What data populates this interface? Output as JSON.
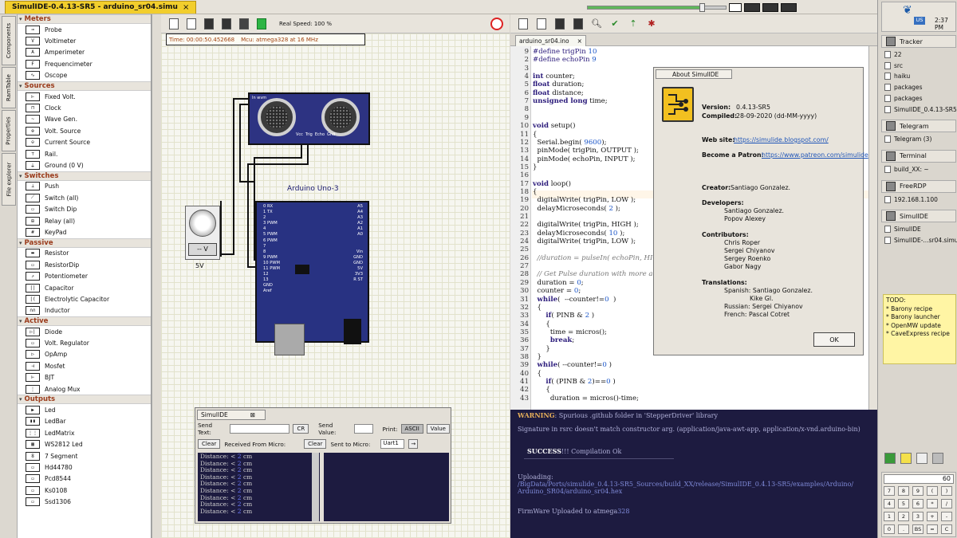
{
  "window": {
    "title": "SimulIDE-0.4.13-SR5  -  arduino_sr04.simu",
    "close": "×"
  },
  "vtabs": [
    "Components",
    "RamTable",
    "Properties",
    "File explorer"
  ],
  "components": [
    {
      "category": "Meters",
      "items": [
        {
          "icon": "probe-icon",
          "glyph": "⊸",
          "label": "Probe"
        },
        {
          "icon": "voltimeter-icon",
          "glyph": "V",
          "label": "Voltimeter"
        },
        {
          "icon": "amperimeter-icon",
          "glyph": "A",
          "label": "Amperimeter"
        },
        {
          "icon": "frequencimeter-icon",
          "glyph": "F",
          "label": "Frequencimeter"
        },
        {
          "icon": "oscope-icon",
          "glyph": "∿",
          "label": "Oscope"
        }
      ]
    },
    {
      "category": "Sources",
      "items": [
        {
          "icon": "fixed-volt-icon",
          "glyph": "⊢",
          "label": "Fixed Volt."
        },
        {
          "icon": "clock-icon",
          "glyph": "⊓",
          "label": "Clock"
        },
        {
          "icon": "wave-gen-icon",
          "glyph": "~",
          "label": "Wave Gen."
        },
        {
          "icon": "volt-source-icon",
          "glyph": "⊕",
          "label": "Volt. Source"
        },
        {
          "icon": "current-source-icon",
          "glyph": "⊖",
          "label": "Current Source"
        },
        {
          "icon": "rail-icon",
          "glyph": "⊤",
          "label": "Rail."
        },
        {
          "icon": "ground-icon",
          "glyph": "⏚",
          "label": "Ground (0 V)"
        }
      ]
    },
    {
      "category": "Switches",
      "items": [
        {
          "icon": "push-icon",
          "glyph": "⊥",
          "label": "Push"
        },
        {
          "icon": "switch-all-icon",
          "glyph": "⟋",
          "label": "Switch (all)"
        },
        {
          "icon": "switch-dip-icon",
          "glyph": "▭",
          "label": "Switch Dip"
        },
        {
          "icon": "relay-icon",
          "glyph": "⊞",
          "label": "Relay (all)"
        },
        {
          "icon": "keypad-icon",
          "glyph": "#",
          "label": "KeyPad"
        }
      ]
    },
    {
      "category": "Passive",
      "items": [
        {
          "icon": "resistor-icon",
          "glyph": "▬",
          "label": "Resistor"
        },
        {
          "icon": "resistor-dip-icon",
          "glyph": "▭",
          "label": "ResistorDip"
        },
        {
          "icon": "potentiometer-icon",
          "glyph": "↗",
          "label": "Potentiometer"
        },
        {
          "icon": "capacitor-icon",
          "glyph": "||",
          "label": "Capacitor"
        },
        {
          "icon": "electrolytic-capacitor-icon",
          "glyph": "|(",
          "label": "Electrolytic Capacitor"
        },
        {
          "icon": "inductor-icon",
          "glyph": "∩∩",
          "label": "Inductor"
        }
      ]
    },
    {
      "category": "Active",
      "items": [
        {
          "icon": "diode-icon",
          "glyph": "▷|",
          "label": "Diode"
        },
        {
          "icon": "volt-regulator-icon",
          "glyph": "▭",
          "label": "Volt. Regulator"
        },
        {
          "icon": "opamp-icon",
          "glyph": "▷",
          "label": "OpAmp"
        },
        {
          "icon": "mosfet-icon",
          "glyph": "⊣",
          "label": "Mosfet"
        },
        {
          "icon": "bjt-icon",
          "glyph": "⊢",
          "label": "BJT"
        },
        {
          "icon": "analog-mux-icon",
          "glyph": "⋮",
          "label": "Analog Mux"
        }
      ]
    },
    {
      "category": "Outputs",
      "items": [
        {
          "icon": "led-icon",
          "glyph": "▶",
          "label": "Led"
        },
        {
          "icon": "ledbar-icon",
          "glyph": "▮▮",
          "label": "LedBar"
        },
        {
          "icon": "ledmatrix-icon",
          "glyph": "⋮⋮",
          "label": "LedMatrix"
        },
        {
          "icon": "ws2812-icon",
          "glyph": "▦",
          "label": "WS2812 Led"
        },
        {
          "icon": "seven-segment-icon",
          "glyph": "8",
          "label": "7 Segment"
        },
        {
          "icon": "hd44780-icon",
          "glyph": "▭",
          "label": "Hd44780"
        },
        {
          "icon": "pcd8544-icon",
          "glyph": "▭",
          "label": "Pcd8544"
        },
        {
          "icon": "ks0108-icon",
          "glyph": "▭",
          "label": "Ks0108"
        },
        {
          "icon": "ssd1306-icon",
          "glyph": "▭",
          "label": "Ssd1306"
        }
      ]
    }
  ],
  "circuit": {
    "real_speed": "Real Speed: 100 %",
    "time": "Time: 00:00:50.452668",
    "mcu": "Mcu: atmega328 at 16 MHz",
    "sonar_label": "In  wvm",
    "sonar_pins": [
      "Vcc",
      "Trig",
      "Echo",
      "Gnd"
    ],
    "arduino_title": "Arduino Uno-3",
    "arduino_left_pins": [
      "0  RX",
      "1  TX",
      "2",
      "3  PWM",
      "4",
      "5  PWM",
      "6  PWM",
      "7",
      "8",
      "9   PWM",
      "10 PWM",
      "11 PWM",
      "12",
      "13",
      "GND",
      "Aref"
    ],
    "arduino_right_pins": [
      "A5",
      "A4",
      "A3",
      "A2",
      "A1",
      "A0",
      "",
      "",
      "Vin",
      "GND",
      "GND",
      "5V",
      "3V3",
      "R ST"
    ],
    "volt_button": "-- V",
    "volt_value": "5V"
  },
  "serial": {
    "tab": "SimulIDE",
    "close": "⊠",
    "send_text_label": "Send Text:",
    "cr": "CR",
    "send_value_label": "Send Value:",
    "print_label": "Print:",
    "ascii": "ASCII",
    "value": "Value",
    "clear1": "Clear",
    "received_label": "Received From Micro:",
    "clear2": "Clear",
    "sent_label": "Sent to Micro:",
    "port": "Uart1",
    "port_arrow": "→",
    "rx_lines": [
      {
        "t": "Distance: < ",
        "n": "2",
        "u": " cm"
      },
      {
        "t": "Distance: < ",
        "n": "2",
        "u": " cm"
      },
      {
        "t": "Distance: < ",
        "n": "2",
        "u": " cm"
      },
      {
        "t": "Distance: < ",
        "n": "2",
        "u": " cm"
      },
      {
        "t": "Distance: < ",
        "n": "2",
        "u": " cm"
      },
      {
        "t": "Distance: < ",
        "n": "2",
        "u": " cm"
      },
      {
        "t": "Distance: < ",
        "n": "2",
        "u": " cm"
      },
      {
        "t": "Distance: < ",
        "n": "2",
        "u": " cm"
      },
      {
        "t": "Distance: < ",
        "n": "2",
        "u": " cm"
      }
    ]
  },
  "editor": {
    "tab": "arduino_sr04.ino",
    "tab_close": "×",
    "lines": [
      {
        "n": "9",
        "html": "<span class='pp'>#define trigPin</span> <span class='num'>10</span>"
      },
      {
        "n": "2",
        "html": "<span class='pp'>#define echoPin</span> <span class='num'>9</span>"
      },
      {
        "n": "3",
        "html": ""
      },
      {
        "n": "4",
        "html": "<span class='kw'>int</span> counter;"
      },
      {
        "n": "5",
        "html": "<span class='kw'>float</span> duration;"
      },
      {
        "n": "6",
        "html": "<span class='kw'>float</span> distance;"
      },
      {
        "n": "7",
        "html": "<span class='kw'>unsigned long</span> time;"
      },
      {
        "n": "8",
        "html": ""
      },
      {
        "n": "9",
        "html": ""
      },
      {
        "n": "10",
        "html": "<span class='kw'>void</span> setup()"
      },
      {
        "n": "11",
        "html": "{"
      },
      {
        "n": "12",
        "html": "  Serial.begin( <span class='num'>9600</span>);"
      },
      {
        "n": "13",
        "html": "  pinMode( trigPin, OUTPUT );"
      },
      {
        "n": "14",
        "html": "  pinMode( echoPin, INPUT );"
      },
      {
        "n": "15",
        "html": "}"
      },
      {
        "n": "16",
        "html": ""
      },
      {
        "n": "17",
        "html": "<span class='kw'>void</span> loop()"
      },
      {
        "n": "18",
        "html": "{"
      },
      {
        "n": "19",
        "html": "  digitalWrite( trigPin, LOW );"
      },
      {
        "n": "20",
        "html": "  delayMicroseconds( <span class='num'>2</span> );"
      },
      {
        "n": "21",
        "html": ""
      },
      {
        "n": "22",
        "html": "  digitalWrite( trigPin, HIGH );"
      },
      {
        "n": "23",
        "html": "  delayMicroseconds( <span class='num'>10</span> );"
      },
      {
        "n": "24",
        "html": "  digitalWrite( trigPin, LOW );"
      },
      {
        "n": "25",
        "html": ""
      },
      {
        "n": "26",
        "html": "  <span class='cm'>//duration = pulseIn( echoPin, HIGH );</span>"
      },
      {
        "n": "27",
        "html": ""
      },
      {
        "n": "28",
        "html": "  <span class='cm'>// Get Pulse duration with more accuracy</span>"
      },
      {
        "n": "29",
        "html": "  duration = <span class='num'>0</span>;"
      },
      {
        "n": "30",
        "html": "  counter = <span class='num'>0</span>;"
      },
      {
        "n": "31",
        "html": "  <span class='kw'>while</span>(  --counter!=<span class='num'>0</span>  )"
      },
      {
        "n": "32",
        "html": "  {"
      },
      {
        "n": "33",
        "html": "      <span class='kw'>if</span>( PINB &amp; <span class='num'>2</span> )"
      },
      {
        "n": "34",
        "html": "      {"
      },
      {
        "n": "35",
        "html": "        time = micros();"
      },
      {
        "n": "36",
        "html": "        <span class='kw'>break</span>;"
      },
      {
        "n": "37",
        "html": "      }"
      },
      {
        "n": "38",
        "html": "  }"
      },
      {
        "n": "39",
        "html": "  <span class='kw'>while</span>( --counter!=<span class='num'>0</span> )"
      },
      {
        "n": "40",
        "html": "  {"
      },
      {
        "n": "41",
        "html": "      <span class='kw'>if</span>( (PINB &amp; <span class='num'>2</span>)==<span class='num'>0</span> )"
      },
      {
        "n": "42",
        "html": "      {"
      },
      {
        "n": "43",
        "html": "        duration = micros()-time;"
      }
    ]
  },
  "about": {
    "title": "About SimulIDE",
    "version_label": "Version:",
    "version": "0.4.13-SR5",
    "compiled_label": "Compiled:",
    "compiled": "28-09-2020 (dd-MM-yyyy)",
    "website_label": "Web site:",
    "website": "https://simulide.blogspot.com/",
    "patron_label": "Become a Patron:",
    "patron": "https://www.patreon.com/simulide",
    "creator_label": "Creator:",
    "creator": "Santiago Gonzalez.",
    "developers_label": "Developers:",
    "developers": [
      "Santiago Gonzalez.",
      "Popov Alexey"
    ],
    "contributors_label": "Contributors:",
    "contributors": [
      "Chris Roper",
      "Sergei Chiyanov",
      "Sergey Roenko",
      "Gabor Nagy"
    ],
    "translations_label": "Translations:",
    "translations": [
      "Spanish: Santiago Gonzalez.",
      "Kike Gl.",
      "Russian: Sergei Chiyanov",
      "French: Pascal Cotret"
    ],
    "ok": "OK"
  },
  "console": {
    "warning_key": "WARNING",
    "warning": ": Spurious .github folder in 'StepperDriver' library",
    "signature": "Signature in rsrc doesn't match constructor arg. (application/java-awt-app, application/x-vnd.arduino-bin)",
    "success_key": "SUCCESS",
    "success": "!!! Compilation Ok",
    "rule": "_______________________________________________",
    "uploading": "Uploading:",
    "path1": "/BigData/Ports/simulide_0.4.13-SR5_Sources/build_XX/release/SimulIDE_0.4.13-SR5/examples/Arduino/",
    "path2": "Arduino_SR04/arduino_sr04.hex",
    "uploaded": "FirmWare Uploaded to atmega",
    "uploaded_num": "328"
  },
  "deskbar": {
    "clock": "2:37 PM",
    "locale": "US",
    "apps": [
      {
        "name": "Tracker",
        "icon": "tracker-icon",
        "subs": [
          "22",
          "src",
          "haiku",
          "packages",
          "packages",
          "SimulIDE_0.4.13-SR5"
        ]
      },
      {
        "name": "Telegram",
        "icon": "telegram-icon",
        "subs": [
          "Telegram (3)"
        ]
      },
      {
        "name": "Terminal",
        "icon": "terminal-icon",
        "subs": [
          "build_XX: ~"
        ]
      },
      {
        "name": "FreeRDP",
        "icon": "freerdp-icon",
        "subs": [
          "192.168.1.100"
        ]
      },
      {
        "name": "SimulIDE",
        "icon": "simulide-icon",
        "subs": [
          "SimulIDE",
          "SimulIDE-...sr04.simu"
        ]
      }
    ],
    "todo_title": "TODO:",
    "todo": [
      "* Barony recipe",
      "* Barony launcher",
      "* OpenMW update",
      "* CaveExpress recipe"
    ],
    "calc_display": "60",
    "calc_keys": [
      "7",
      "8",
      "9",
      "(",
      ")",
      "4",
      "5",
      "6",
      "*",
      "/",
      "1",
      "2",
      "3",
      "+",
      "-",
      "0",
      ".",
      "BS",
      "=",
      "C"
    ]
  },
  "colors": {
    "accent": "#f2ce2c",
    "board": "#283282",
    "console_bg": "#1d1b40"
  }
}
